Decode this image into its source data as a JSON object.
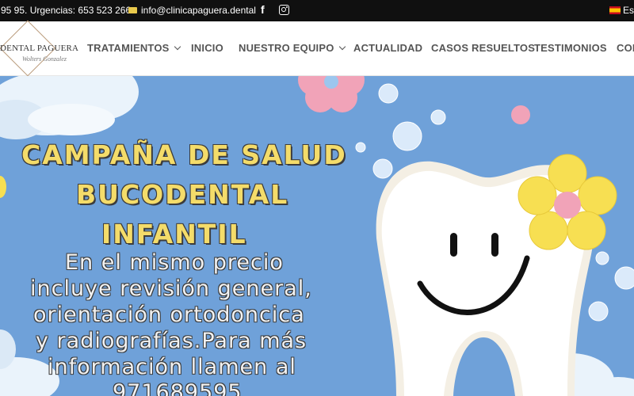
{
  "topbar": {
    "phones": "95 95. Urgencias: 653 523 266",
    "email": "info@clinicapaguera.dental",
    "language": "Esp"
  },
  "logo": {
    "name": "DENTAL PAGUERA",
    "signature": "Wolters Gonzalez"
  },
  "nav": [
    {
      "label": "TRATAMIENTOS"
    },
    {
      "label": "INICIO"
    },
    {
      "label": "NUESTRO EQUIPO"
    },
    {
      "label": "ACTUALIDAD"
    },
    {
      "label": "CASOS RESUELTOS"
    },
    {
      "label": "TESTIMONIOS"
    },
    {
      "label": "CON"
    }
  ],
  "hero": {
    "title_lines": [
      "CAMPAÑA DE SALUD",
      "BUCODENTAL",
      "INFANTIL"
    ],
    "body_lines": [
      "En el mismo precio",
      "incluye revisión general,",
      "orientación ortodoncica",
      "y radiografías.Para más",
      "información llamen al",
      "971689595"
    ]
  },
  "colors": {
    "topbar_bg": "#101010",
    "hero_bg": "#6fa1d9",
    "title_yellow": "#f4dc6a",
    "flower_yellow": "#f7df52",
    "flower_pink": "#f1a3b8"
  }
}
